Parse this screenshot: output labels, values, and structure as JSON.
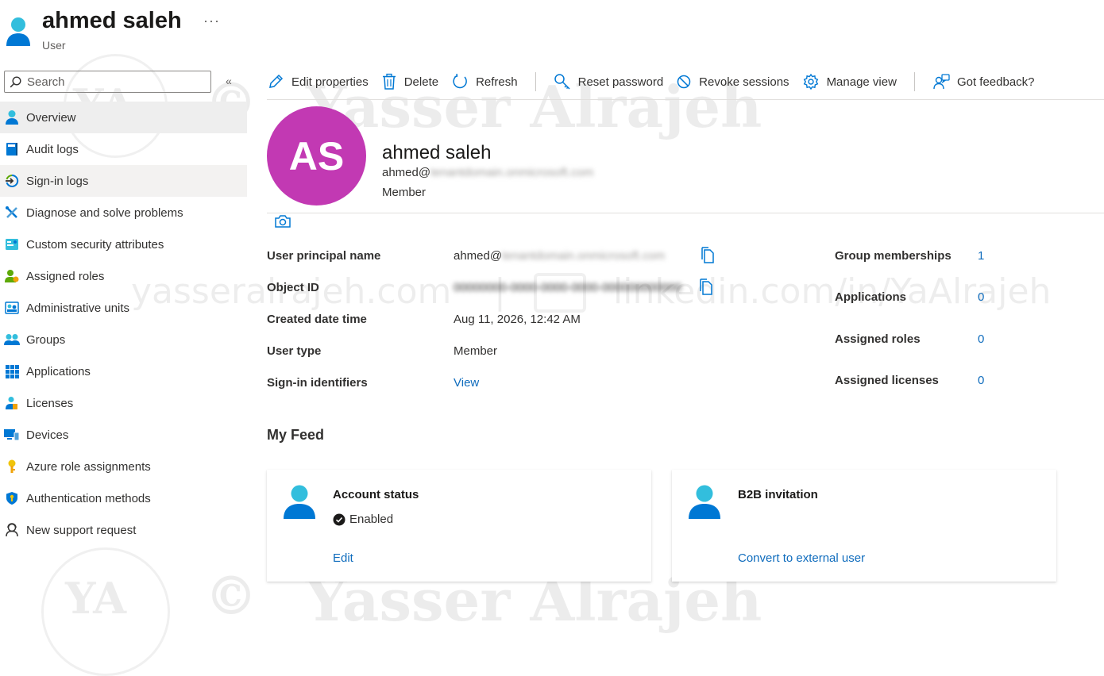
{
  "header": {
    "title": "ahmed saleh",
    "subtitle": "User",
    "more": "···"
  },
  "search": {
    "placeholder": "Search",
    "value": ""
  },
  "sidebar": {
    "collapse": "«",
    "items": [
      {
        "label": "Overview",
        "icon": "user-icon"
      },
      {
        "label": "Audit logs",
        "icon": "book-icon"
      },
      {
        "label": "Sign-in logs",
        "icon": "sign-in-icon"
      },
      {
        "label": "Diagnose and solve problems",
        "icon": "wrench-icon"
      },
      {
        "label": "Custom security attributes",
        "icon": "attributes-icon"
      },
      {
        "label": "Assigned roles",
        "icon": "role-icon"
      },
      {
        "label": "Administrative units",
        "icon": "admin-units-icon"
      },
      {
        "label": "Groups",
        "icon": "groups-icon"
      },
      {
        "label": "Applications",
        "icon": "apps-grid-icon"
      },
      {
        "label": "Licenses",
        "icon": "license-icon"
      },
      {
        "label": "Devices",
        "icon": "devices-icon"
      },
      {
        "label": "Azure role assignments",
        "icon": "key-icon"
      },
      {
        "label": "Authentication methods",
        "icon": "shield-icon"
      },
      {
        "label": "New support request",
        "icon": "support-icon"
      }
    ]
  },
  "toolbar": {
    "edit": "Edit properties",
    "delete": "Delete",
    "refresh": "Refresh",
    "reset": "Reset password",
    "revoke": "Revoke sessions",
    "manage": "Manage view",
    "feedback": "Got feedback?"
  },
  "profile": {
    "initials": "AS",
    "name": "ahmed saleh",
    "email_prefix": "ahmed@",
    "email_domain_redacted": "tenantdomain.onmicrosoft.com",
    "user_type": "Member"
  },
  "props": {
    "upn_label": "User principal name",
    "upn_prefix": "ahmed@",
    "upn_redacted": "tenantdomain.onmicrosoft.com",
    "objid_label": "Object ID",
    "objid_redacted": "00000000-0000-0000-0000-000000000000",
    "created_label": "Created date time",
    "created_value": "Aug 11, 2026, 12:42 AM",
    "usertype_label": "User type",
    "usertype_value": "Member",
    "signin_label": "Sign-in identifiers",
    "signin_value": "View"
  },
  "stats": {
    "groups_label": "Group memberships",
    "groups_value": "1",
    "apps_label": "Applications",
    "apps_value": "0",
    "roles_label": "Assigned roles",
    "roles_value": "0",
    "licenses_label": "Assigned licenses",
    "licenses_value": "0"
  },
  "feed": {
    "title": "My Feed",
    "account_title": "Account status",
    "account_status": "Enabled",
    "account_link": "Edit",
    "b2b_title": "B2B invitation",
    "b2b_link": "Convert to external user"
  },
  "watermark": {
    "mark": "YA",
    "copyright": "©",
    "name": "Yasser Alrajeh",
    "website": "yasseralrajeh.com",
    "divider": "|",
    "linkedin": "linkedin.com/in/YaAlrajeh"
  },
  "colors": {
    "accent": "#0f6cbd",
    "avatar": "#c239b3",
    "active_nav": "#eeeeee"
  }
}
